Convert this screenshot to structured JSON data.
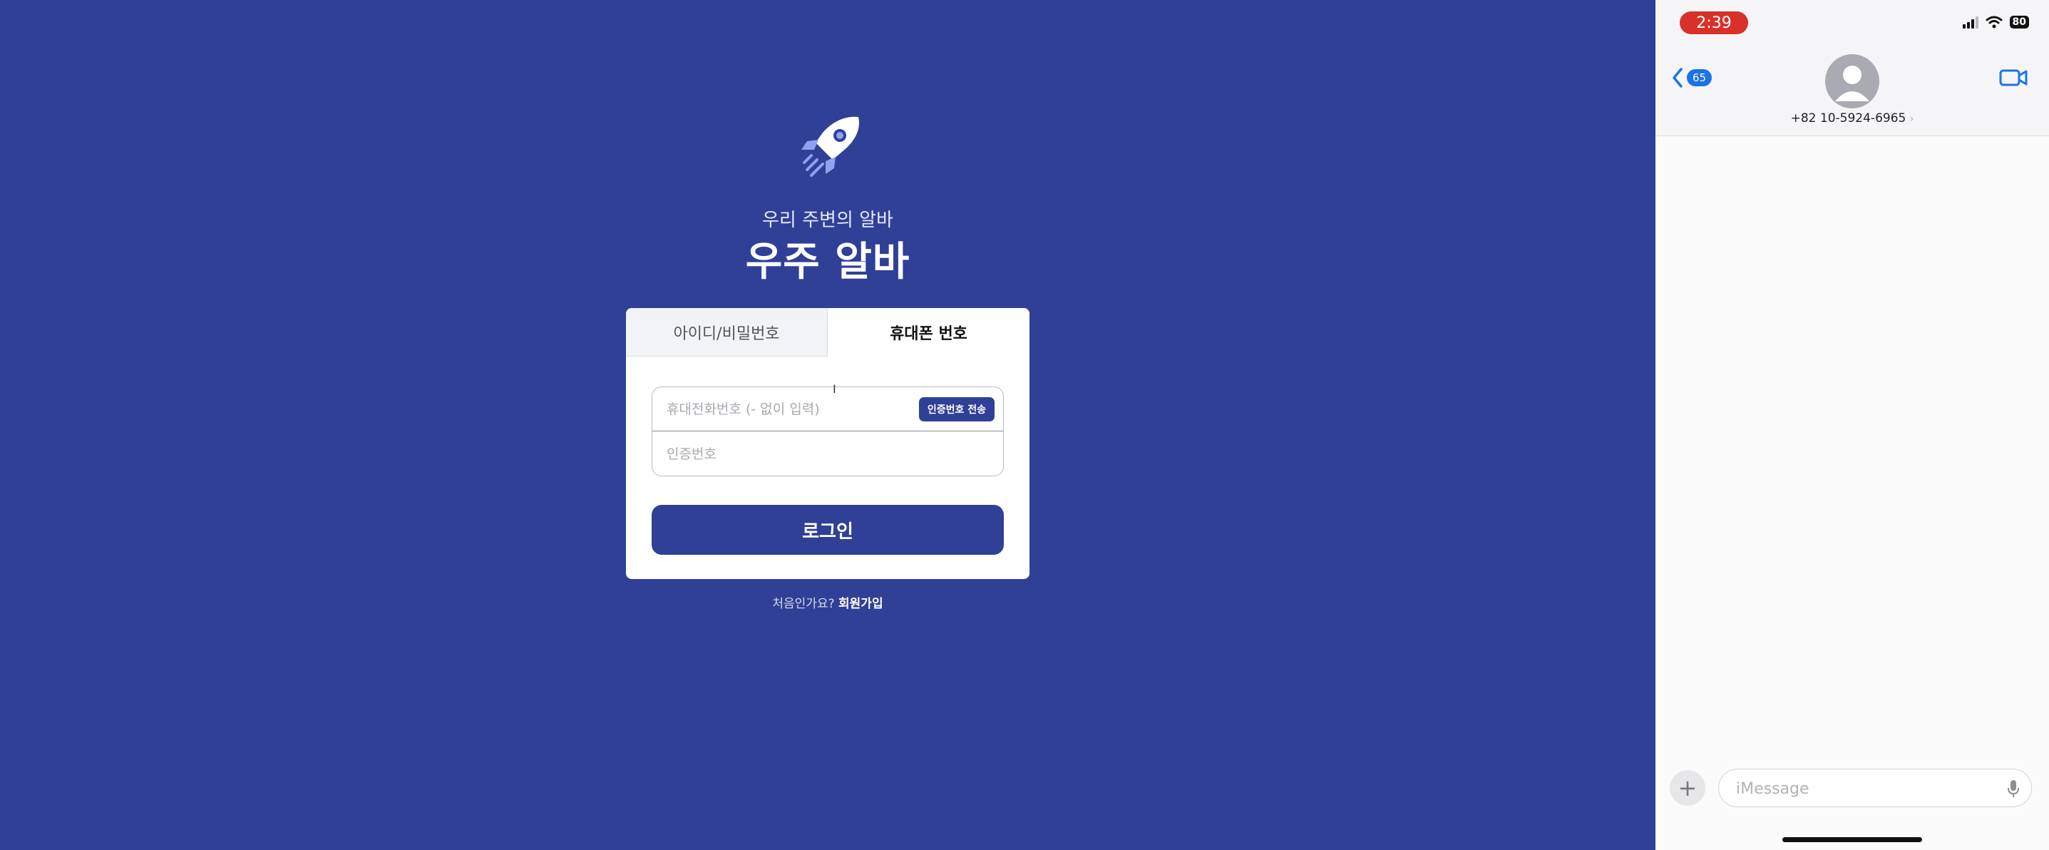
{
  "web": {
    "subtitle": "우리 주변의 알바",
    "title": "우주 알바",
    "tabs": [
      {
        "label": "아이디/비밀번호",
        "active": false
      },
      {
        "label": "휴대폰 번호",
        "active": true
      }
    ],
    "phone_field": {
      "placeholder": "휴대전화번호 (- 없이 입력)",
      "value": ""
    },
    "code_field": {
      "placeholder": "인증번호",
      "value": ""
    },
    "send_code_button": "인증번호 전송",
    "login_button": "로그인",
    "signup_prompt": "처음인가요?",
    "signup_link": "회원가입",
    "cursor": "I",
    "colors": {
      "brand": "#2f4096",
      "accent": "#8fa2f0"
    },
    "icons": {
      "logo": "rocket-icon"
    }
  },
  "phone": {
    "time": "2:39",
    "battery": "80",
    "back_badge": "65",
    "contact": "+82 10-5924-6965",
    "contact_chevron": "›",
    "plus": "+",
    "imessage_placeholder": "iMessage",
    "icons": [
      "cellular-icon",
      "wifi-icon",
      "battery-icon",
      "back-chevron-icon",
      "avatar-icon",
      "video-call-icon",
      "plus-icon",
      "mic-icon"
    ]
  }
}
